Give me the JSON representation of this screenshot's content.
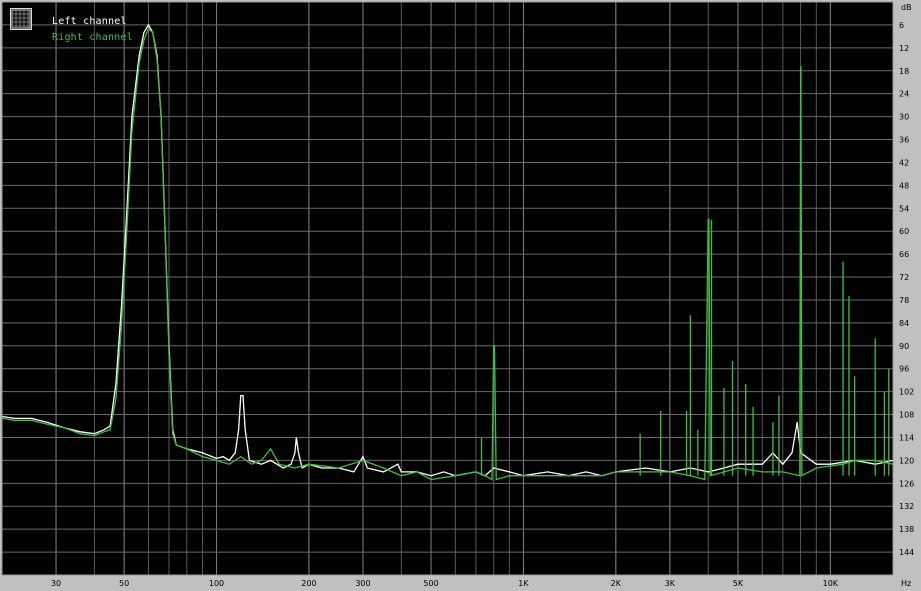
{
  "chart_data": {
    "type": "line",
    "xscale": "log",
    "xlim": [
      20,
      16000
    ],
    "ylim": [
      -150,
      0
    ],
    "ylabel": "dB",
    "xlabel": "Hz",
    "grid": true,
    "legend_placement": "top-left",
    "y_ticks": [
      -6,
      -12,
      -18,
      -24,
      -30,
      -36,
      -42,
      -48,
      -54,
      -60,
      -66,
      -72,
      -78,
      -84,
      -90,
      -96,
      -102,
      -108,
      -114,
      -120,
      -126,
      -132,
      -138,
      -144
    ],
    "y_tick_labels": [
      "6",
      "12",
      "18",
      "24",
      "30",
      "36",
      "42",
      "48",
      "54",
      "60",
      "66",
      "72",
      "78",
      "84",
      "90",
      "96",
      "102",
      "108",
      "114",
      "120",
      "126",
      "132",
      "138",
      "144"
    ],
    "x_ticks": [
      30,
      50,
      100,
      200,
      300,
      500,
      1000,
      2000,
      3000,
      5000,
      10000
    ],
    "x_tick_labels": [
      "30",
      "50",
      "100",
      "200",
      "300",
      "500",
      "1K",
      "2K",
      "3K",
      "5K",
      "10K"
    ],
    "series": [
      {
        "name": "Left channel",
        "color": "#ffffff",
        "points": [
          [
            20,
            -108.5
          ],
          [
            22,
            -109
          ],
          [
            25,
            -109
          ],
          [
            28,
            -110
          ],
          [
            32,
            -111.5
          ],
          [
            36,
            -112.5
          ],
          [
            40,
            -113
          ],
          [
            43,
            -112
          ],
          [
            45,
            -111
          ],
          [
            47,
            -100
          ],
          [
            49,
            -80
          ],
          [
            51,
            -55
          ],
          [
            53,
            -30
          ],
          [
            56,
            -14
          ],
          [
            58,
            -8
          ],
          [
            60,
            -6
          ],
          [
            62,
            -8
          ],
          [
            64,
            -14
          ],
          [
            66,
            -30
          ],
          [
            68,
            -60
          ],
          [
            70,
            -90
          ],
          [
            72,
            -112
          ],
          [
            74,
            -116
          ],
          [
            80,
            -117
          ],
          [
            90,
            -118
          ],
          [
            100,
            -119.5
          ],
          [
            105,
            -119
          ],
          [
            110,
            -120
          ],
          [
            115,
            -118
          ],
          [
            118,
            -112
          ],
          [
            120,
            -103
          ],
          [
            122,
            -103
          ],
          [
            124,
            -112
          ],
          [
            128,
            -120
          ],
          [
            140,
            -121
          ],
          [
            150,
            -120
          ],
          [
            165,
            -122
          ],
          [
            175,
            -121
          ],
          [
            180,
            -118
          ],
          [
            182,
            -114
          ],
          [
            185,
            -118
          ],
          [
            190,
            -122
          ],
          [
            200,
            -121
          ],
          [
            220,
            -122
          ],
          [
            250,
            -122
          ],
          [
            280,
            -123
          ],
          [
            300,
            -119
          ],
          [
            310,
            -122
          ],
          [
            350,
            -123
          ],
          [
            390,
            -121
          ],
          [
            400,
            -123
          ],
          [
            450,
            -123
          ],
          [
            500,
            -124
          ],
          [
            550,
            -123
          ],
          [
            600,
            -124
          ],
          [
            700,
            -123
          ],
          [
            750,
            -124
          ],
          [
            800,
            -122
          ],
          [
            900,
            -123
          ],
          [
            1000,
            -124
          ],
          [
            1200,
            -123
          ],
          [
            1400,
            -124
          ],
          [
            1600,
            -123
          ],
          [
            1800,
            -124
          ],
          [
            2000,
            -123
          ],
          [
            2500,
            -122
          ],
          [
            3000,
            -123
          ],
          [
            3500,
            -122
          ],
          [
            4000,
            -123
          ],
          [
            4500,
            -122
          ],
          [
            5000,
            -121
          ],
          [
            6000,
            -121
          ],
          [
            6500,
            -118
          ],
          [
            7000,
            -121
          ],
          [
            7500,
            -118
          ],
          [
            7800,
            -110
          ],
          [
            8000,
            -118
          ],
          [
            9000,
            -121
          ],
          [
            10000,
            -121
          ],
          [
            12000,
            -120
          ],
          [
            14000,
            -121
          ],
          [
            16000,
            -120
          ]
        ]
      },
      {
        "name": "Right channel",
        "color": "#3fbf3f",
        "points": [
          [
            20,
            -109
          ],
          [
            22,
            -109.5
          ],
          [
            25,
            -109.5
          ],
          [
            28,
            -110.5
          ],
          [
            32,
            -111.5
          ],
          [
            36,
            -113
          ],
          [
            40,
            -113.5
          ],
          [
            43,
            -112.5
          ],
          [
            45,
            -112
          ],
          [
            47,
            -104
          ],
          [
            49,
            -85
          ],
          [
            51,
            -60
          ],
          [
            53,
            -34
          ],
          [
            56,
            -16
          ],
          [
            58,
            -10
          ],
          [
            60,
            -7
          ],
          [
            62,
            -8
          ],
          [
            64,
            -15
          ],
          [
            66,
            -30
          ],
          [
            68,
            -60
          ],
          [
            70,
            -92
          ],
          [
            72,
            -113
          ],
          [
            74,
            -116
          ],
          [
            80,
            -117
          ],
          [
            90,
            -119
          ],
          [
            100,
            -120
          ],
          [
            110,
            -121
          ],
          [
            120,
            -119
          ],
          [
            130,
            -121
          ],
          [
            140,
            -120
          ],
          [
            150,
            -117
          ],
          [
            160,
            -121
          ],
          [
            180,
            -122
          ],
          [
            200,
            -121
          ],
          [
            250,
            -122
          ],
          [
            300,
            -120
          ],
          [
            350,
            -122
          ],
          [
            400,
            -124
          ],
          [
            450,
            -123
          ],
          [
            500,
            -125
          ],
          [
            600,
            -124
          ],
          [
            700,
            -123
          ],
          [
            750,
            -124
          ],
          [
            790,
            -125
          ],
          [
            800,
            -90
          ],
          [
            805,
            -90
          ],
          [
            815,
            -125
          ],
          [
            900,
            -124
          ],
          [
            1000,
            -124
          ],
          [
            1200,
            -124
          ],
          [
            1500,
            -124
          ],
          [
            1800,
            -124
          ],
          [
            2000,
            -123
          ],
          [
            2500,
            -123
          ],
          [
            3000,
            -123
          ],
          [
            3500,
            -124
          ],
          [
            3900,
            -125
          ],
          [
            4000,
            -57
          ],
          [
            4020,
            -57
          ],
          [
            4060,
            -124
          ],
          [
            5000,
            -122
          ],
          [
            6000,
            -123
          ],
          [
            7000,
            -123
          ],
          [
            7950,
            -124
          ],
          [
            8000,
            -17
          ],
          [
            8020,
            -17
          ],
          [
            8080,
            -124
          ],
          [
            9000,
            -122
          ],
          [
            11000,
            -121
          ],
          [
            12000,
            -120
          ],
          [
            14000,
            -120
          ],
          [
            16000,
            -121
          ]
        ],
        "spikes": [
          [
            730,
            -114
          ],
          [
            2400,
            -113
          ],
          [
            2800,
            -107
          ],
          [
            3400,
            -107
          ],
          [
            3500,
            -82
          ],
          [
            3700,
            -112
          ],
          [
            4100,
            -57
          ],
          [
            4500,
            -101
          ],
          [
            4800,
            -94
          ],
          [
            5300,
            -100
          ],
          [
            5600,
            -106
          ],
          [
            6500,
            -110
          ],
          [
            6800,
            -103
          ],
          [
            11000,
            -68
          ],
          [
            11500,
            -77
          ],
          [
            12000,
            -98
          ],
          [
            14000,
            -88
          ],
          [
            15000,
            -102
          ],
          [
            15500,
            -96
          ]
        ]
      }
    ]
  }
}
